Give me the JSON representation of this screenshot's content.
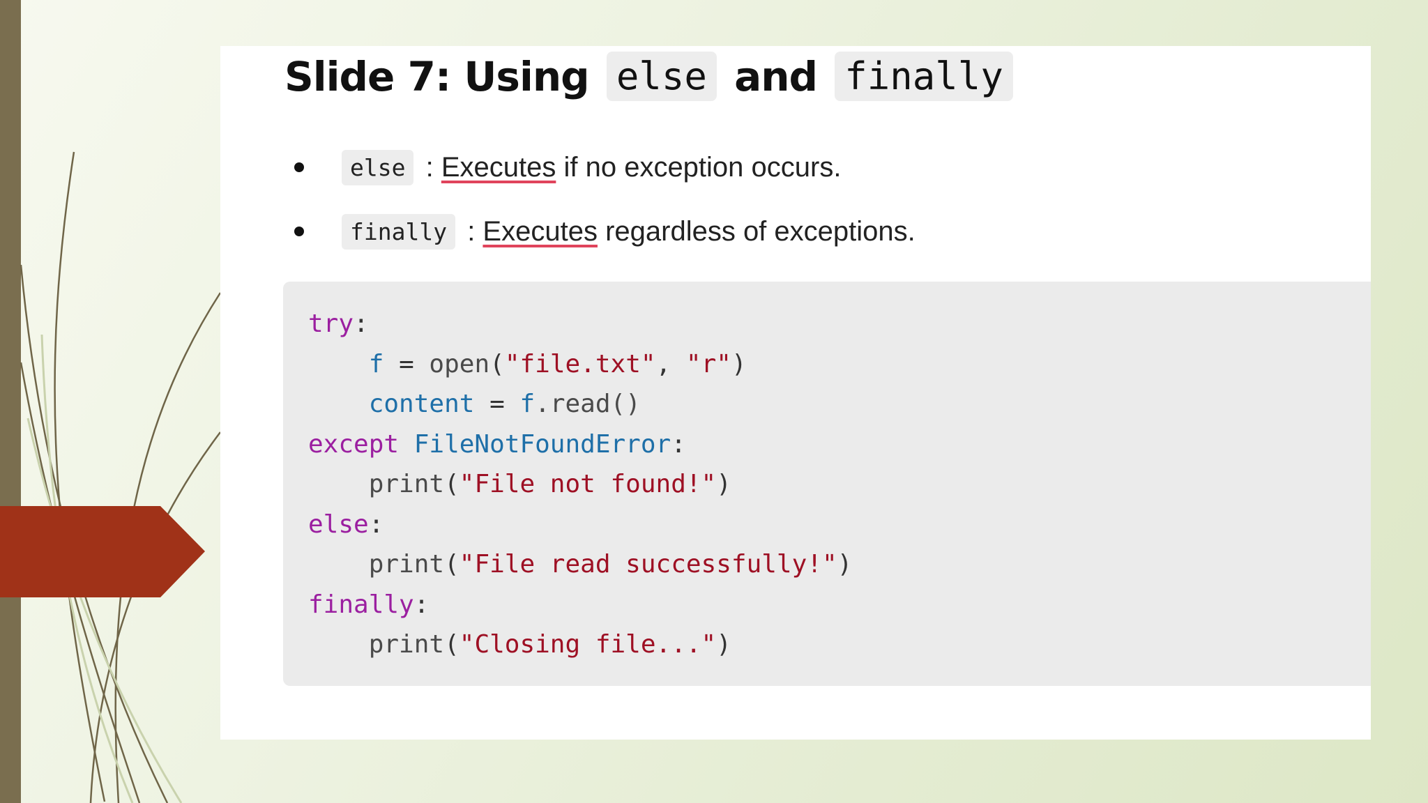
{
  "slide": {
    "title_prefix": "Slide 7: Using",
    "title_code_1": "else",
    "title_and": "and",
    "title_code_2": "finally",
    "bullets": [
      {
        "code": "else",
        "sep": " : ",
        "word": "Executes",
        "rest": " if no exception occurs."
      },
      {
        "code": "finally",
        "sep": " : ",
        "word": "Executes",
        "rest": " regardless of exceptions."
      }
    ]
  },
  "code": {
    "l1_kw": "try",
    "l1_colon": ":",
    "l2_indent": "    ",
    "l2_var": "f",
    "l2_eq": " = ",
    "l2_func": "open",
    "l2_p1": "(",
    "l2_s1": "\"file.txt\"",
    "l2_comma": ", ",
    "l2_s2": "\"r\"",
    "l2_p2": ")",
    "l3_indent": "    ",
    "l3_var": "content",
    "l3_eq": " = ",
    "l3_obj": "f",
    "l3_rest": ".read()",
    "l4_kw": "except",
    "l4_space": " ",
    "l4_exc": "FileNotFoundError",
    "l4_colon": ":",
    "l5_indent": "    ",
    "l5_func": "print",
    "l5_p1": "(",
    "l5_str": "\"File not found!\"",
    "l5_p2": ")",
    "l6_kw": "else",
    "l6_colon": ":",
    "l7_indent": "    ",
    "l7_func": "print",
    "l7_p1": "(",
    "l7_str": "\"File read successfully!\"",
    "l7_p2": ")",
    "l8_kw": "finally",
    "l8_colon": ":",
    "l9_indent": "    ",
    "l9_func": "print",
    "l9_p1": "(",
    "l9_str": "\"Closing file...\"",
    "l9_p2": ")"
  },
  "colors": {
    "left_bar": "#7a6e4f",
    "arrow_tab": "#a03218",
    "keyword": "#9b1fa0",
    "identifier": "#1e6fa8",
    "string": "#9e1024"
  }
}
